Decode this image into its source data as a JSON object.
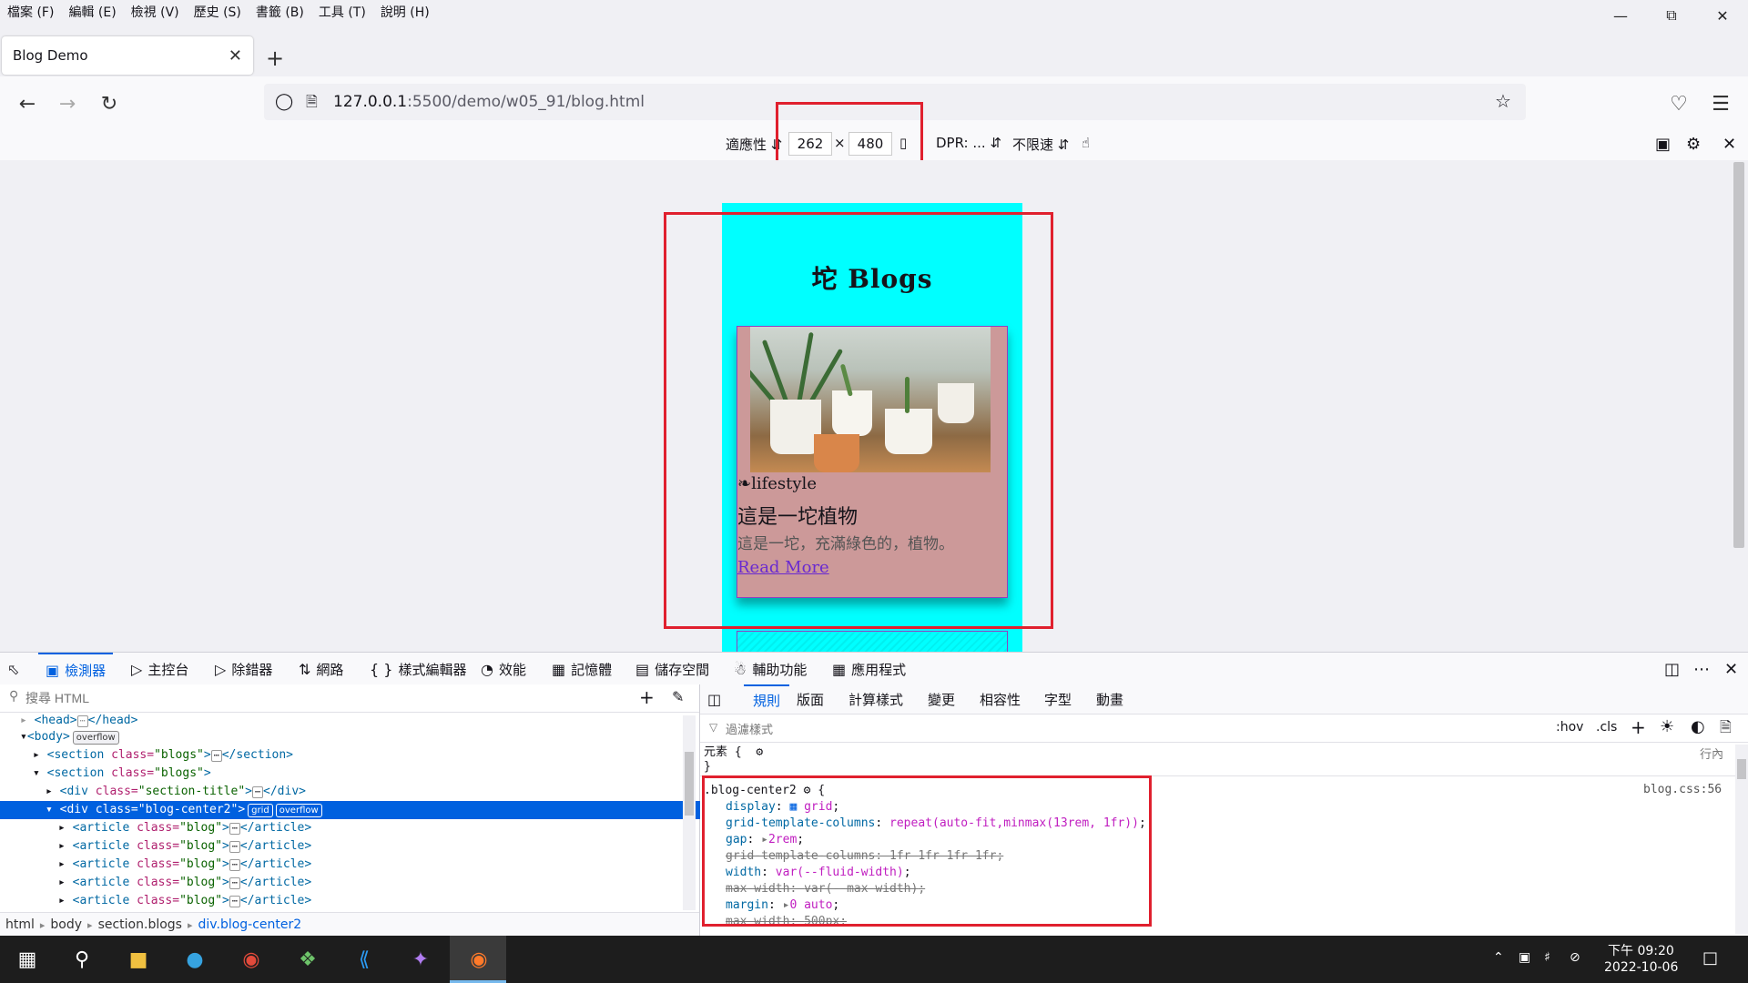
{
  "menubar": {
    "items": [
      "檔案 (F)",
      "編輯 (E)",
      "檢視 (V)",
      "歷史 (S)",
      "書籤 (B)",
      "工具 (T)",
      "說明 (H)"
    ]
  },
  "tab": {
    "title": "Blog Demo"
  },
  "url": {
    "host": "127.0.0.1",
    "path": ":5500/demo/w05_91/blog.html"
  },
  "rdm": {
    "device": "適應性",
    "width": "262",
    "times": "×",
    "height": "480",
    "dpr": "DPR: ...",
    "throttle": "不限速"
  },
  "page": {
    "title": "坨 Blogs",
    "card": {
      "category": "lifestyle",
      "heading": "這是一坨植物",
      "text": "這是一坨，充滿綠色的，植物。",
      "link": "Read More"
    }
  },
  "devtools": {
    "tabs": [
      "檢測器",
      "主控台",
      "除錯器",
      "網路",
      "樣式編輯器",
      "效能",
      "記憶體",
      "儲存空間",
      "輔助功能",
      "應用程式"
    ],
    "search_placeholder": "搜尋 HTML",
    "rules_tabs": [
      "規則",
      "版面",
      "計算樣式",
      "變更",
      "相容性",
      "字型",
      "動畫"
    ],
    "filter_placeholder": "過濾樣式",
    "hov": ":hov",
    "cls": ".cls",
    "element_rule": "元素 {",
    "element_close": "}",
    "inline": "行內",
    "rule_source": "blog.css:56",
    "breadcrumbs": [
      "html",
      "body",
      "section.blogs",
      "div.blog-center2"
    ]
  },
  "taskbar": {
    "time": "下午 09:20",
    "date": "2022-10-06"
  },
  "colors": {
    "accent": "#0061e0",
    "highlight_box": "#e0202e",
    "page_bg": "#00ffff",
    "card_bg": "#cc9999"
  }
}
